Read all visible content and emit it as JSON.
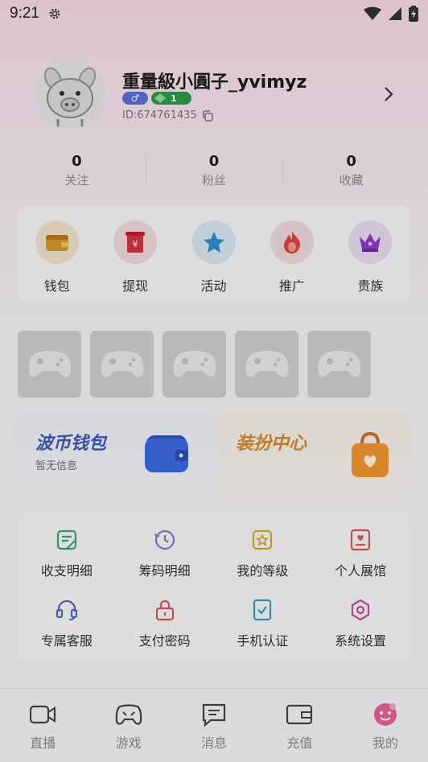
{
  "status_bar": {
    "time": "9:21",
    "icons": [
      "gear-icon",
      "wifi-icon",
      "signal-icon",
      "battery-icon"
    ]
  },
  "profile": {
    "username": "重量級小圓子_yvimyz",
    "gender_badge": "♂",
    "level_badge": "1",
    "user_id": "ID:674761435"
  },
  "stats": [
    {
      "value": "0",
      "label": "关注"
    },
    {
      "value": "0",
      "label": "粉丝"
    },
    {
      "value": "0",
      "label": "收藏"
    }
  ],
  "quick_actions": [
    {
      "label": "钱包",
      "icon": "wallet-icon"
    },
    {
      "label": "提现",
      "icon": "withdraw-icon"
    },
    {
      "label": "活动",
      "icon": "star-icon"
    },
    {
      "label": "推广",
      "icon": "flame-icon"
    },
    {
      "label": "贵族",
      "icon": "crown-icon"
    }
  ],
  "game_tiles": 5,
  "promos": {
    "wallet": {
      "title": "波币钱包",
      "subtitle": "暂无信息"
    },
    "dress": {
      "title": "装扮中心"
    }
  },
  "menu": [
    {
      "label": "收支明细",
      "icon": "ledger-icon"
    },
    {
      "label": "筹码明细",
      "icon": "history-icon"
    },
    {
      "label": "我的等级",
      "icon": "level-icon"
    },
    {
      "label": "个人展馆",
      "icon": "gallery-icon"
    },
    {
      "label": "专属客服",
      "icon": "headset-icon"
    },
    {
      "label": "支付密码",
      "icon": "lock-icon"
    },
    {
      "label": "手机认证",
      "icon": "phone-verify-icon"
    },
    {
      "label": "系统设置",
      "icon": "settings-icon"
    }
  ],
  "tabs": [
    {
      "label": "直播",
      "icon": "live-icon"
    },
    {
      "label": "游戏",
      "icon": "gamepad-icon"
    },
    {
      "label": "消息",
      "icon": "message-icon"
    },
    {
      "label": "充值",
      "icon": "recharge-icon"
    },
    {
      "label": "我的",
      "icon": "profile-icon",
      "active": true
    }
  ],
  "colors": {
    "wallet_title": "#3e5ab8",
    "dress_title": "#d9892e",
    "menu_green": "#3da86a",
    "menu_purple": "#8a78c8",
    "menu_gold": "#d6a836",
    "menu_red": "#d85656",
    "menu_teal": "#3a9ec4",
    "menu_blue": "#4f66c8",
    "menu_pink": "#c6479c"
  }
}
